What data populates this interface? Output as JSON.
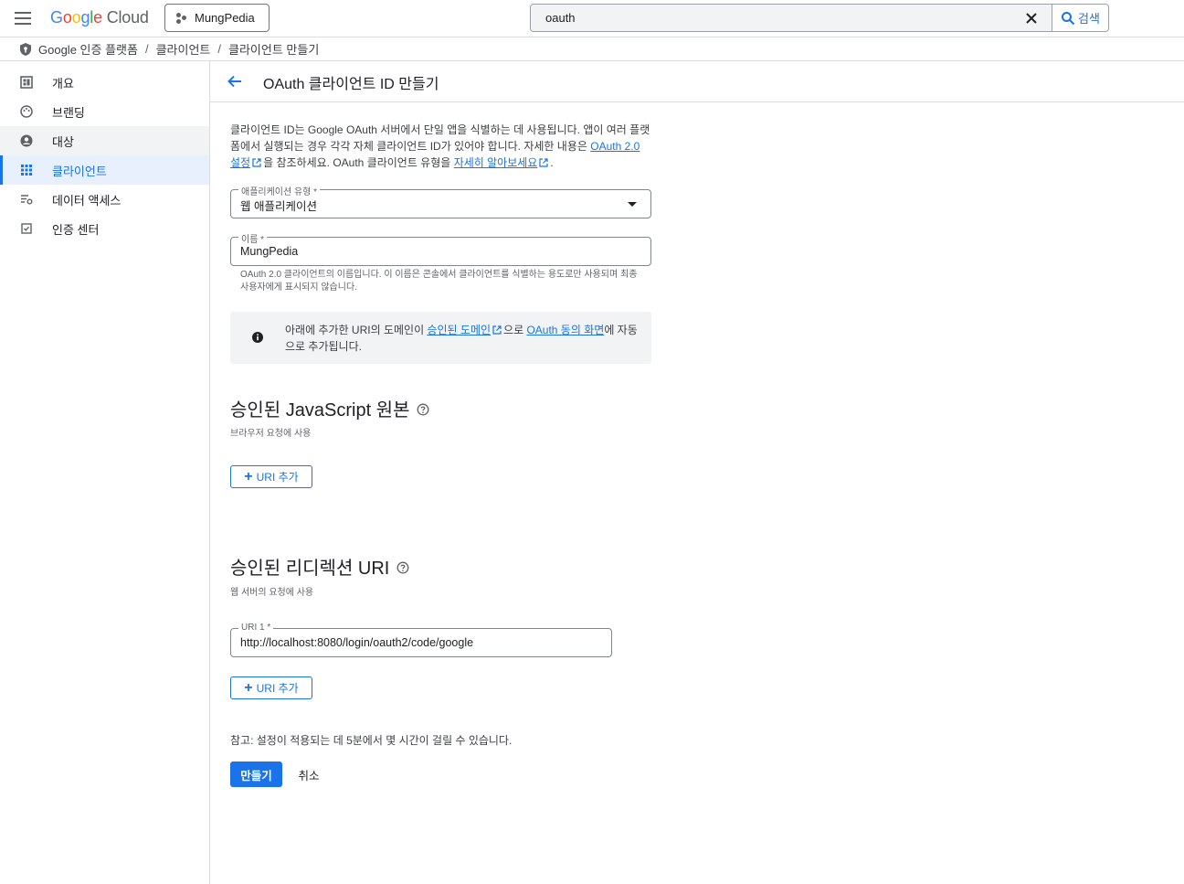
{
  "topbar": {
    "logo": {
      "letters": [
        "G",
        "o",
        "o",
        "g",
        "l",
        "e"
      ],
      "product": "Cloud"
    },
    "project": "MungPedia",
    "search": {
      "value": "oauth",
      "button_label": "검색"
    }
  },
  "breadcrumb": [
    "Google 인증 플랫폼",
    "클라이언트",
    "클라이언트 만들기"
  ],
  "sidebar": {
    "items": [
      {
        "label": "개요",
        "icon": "dashboard-icon"
      },
      {
        "label": "브랜딩",
        "icon": "palette-icon"
      },
      {
        "label": "대상",
        "icon": "account-circle-icon"
      },
      {
        "label": "클라이언트",
        "icon": "apps-grid-icon"
      },
      {
        "label": "데이터 액세스",
        "icon": "data-settings-icon"
      },
      {
        "label": "인증 센터",
        "icon": "verified-check-icon"
      }
    ],
    "active": "클라이언트",
    "hovered": "대상"
  },
  "header": {
    "title": "OAuth 클라이언트 ID 만들기"
  },
  "intro": {
    "line1": "클라이언트 ID는 Google OAuth 서버에서 단일 앱을 식별하는 데 사용됩니다. 앱이 여러 플랫폼에서 실행되는 경우 각각 자체 클라이언트 ID가 있어야 합니다. 자세한 내용은 ",
    "link1": "OAuth 2.0 설정",
    "middle": "을 참조하세요. OAuth 클라이언트 유형을 ",
    "link2": "자세히 알아보세요",
    "end": "."
  },
  "app_type": {
    "label": "애플리케이션 유형 *",
    "value": "웹 애플리케이션"
  },
  "name_field": {
    "label": "이름 *",
    "value": "MungPedia",
    "hint": "OAuth 2.0 클라이언트의 이름입니다. 이 이름은 콘솔에서 클라이언트를 식별하는 용도로만 사용되며 최종 사용자에게 표시되지 않습니다."
  },
  "info": {
    "pre": "아래에 추가한 URI의 도메인이 ",
    "link1": "승인된 도메인",
    "mid": "으로 ",
    "link2": "OAuth 동의 화면",
    "post": "에 자동으로 추가됩니다."
  },
  "js_origins": {
    "title": "승인된 JavaScript 원본",
    "subtitle": "브라우저 요청에 사용",
    "add_label": "URI 추가"
  },
  "redirect_uris": {
    "title": "승인된 리디렉션 URI",
    "subtitle": "웹 서버의 요청에 사용",
    "uri1_label": "URI 1 *",
    "uri1_value": "http://localhost:8080/login/oauth2/code/google",
    "add_label": "URI 추가"
  },
  "note": "참고: 설정이 적용되는 데 5분에서 몇 시간이 걸릴 수 있습니다.",
  "actions": {
    "create": "만들기",
    "cancel": "취소"
  },
  "colors": {
    "accent": "#1a73e8",
    "active_bg": "#e8f0fe",
    "info_bg": "#f1f3f4"
  }
}
